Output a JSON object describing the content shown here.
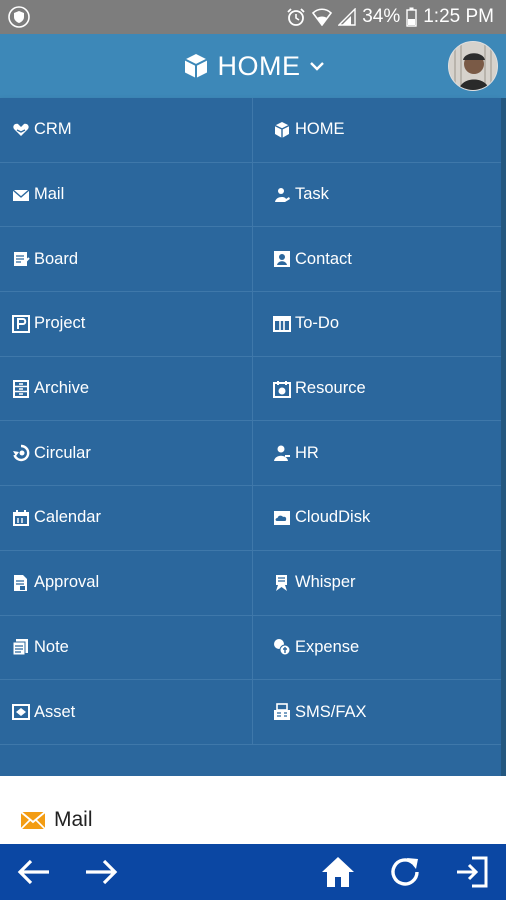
{
  "status_bar": {
    "battery": "34%",
    "time": "1:25 PM",
    "icons": [
      "shield-icon",
      "alarm-icon",
      "wifi-icon",
      "signal-icon",
      "battery-icon"
    ]
  },
  "header": {
    "title": "HOME",
    "icon": "cube-icon",
    "dropdown_icon": "chevron-down-icon"
  },
  "menu": {
    "items": [
      {
        "label": "CRM",
        "icon": "heart-hands-icon"
      },
      {
        "label": "HOME",
        "icon": "cube-icon"
      },
      {
        "label": "Mail",
        "icon": "envelope-icon"
      },
      {
        "label": "Task",
        "icon": "task-person-icon"
      },
      {
        "label": "Board",
        "icon": "board-icon"
      },
      {
        "label": "Contact",
        "icon": "contact-card-icon"
      },
      {
        "label": "Project",
        "icon": "project-icon"
      },
      {
        "label": "To-Do",
        "icon": "todo-icon"
      },
      {
        "label": "Archive",
        "icon": "archive-icon"
      },
      {
        "label": "Resource",
        "icon": "resource-icon"
      },
      {
        "label": "Circular",
        "icon": "circular-icon"
      },
      {
        "label": "HR",
        "icon": "person-icon"
      },
      {
        "label": "Calendar",
        "icon": "calendar-icon"
      },
      {
        "label": "CloudDisk",
        "icon": "cloud-disk-icon"
      },
      {
        "label": "Approval",
        "icon": "approval-icon"
      },
      {
        "label": "Whisper",
        "icon": "whisper-icon"
      },
      {
        "label": "Note",
        "icon": "note-icon"
      },
      {
        "label": "Expense",
        "icon": "expense-icon"
      },
      {
        "label": "Asset",
        "icon": "asset-icon"
      },
      {
        "label": "SMS/FAX",
        "icon": "sms-fax-icon"
      }
    ]
  },
  "content": {
    "mail_label": "Mail",
    "mail_icon": "envelope-icon",
    "mail_icon_color": "#f39c12"
  },
  "colors": {
    "status_bar": "#7d7d7d",
    "header": "#3d88b8",
    "menu": "#2b679d",
    "nav_bar": "#0b47a3"
  },
  "nav_bar": {
    "buttons": [
      "back-arrow-icon",
      "forward-arrow-icon",
      "home-icon",
      "refresh-icon",
      "logout-icon"
    ]
  }
}
